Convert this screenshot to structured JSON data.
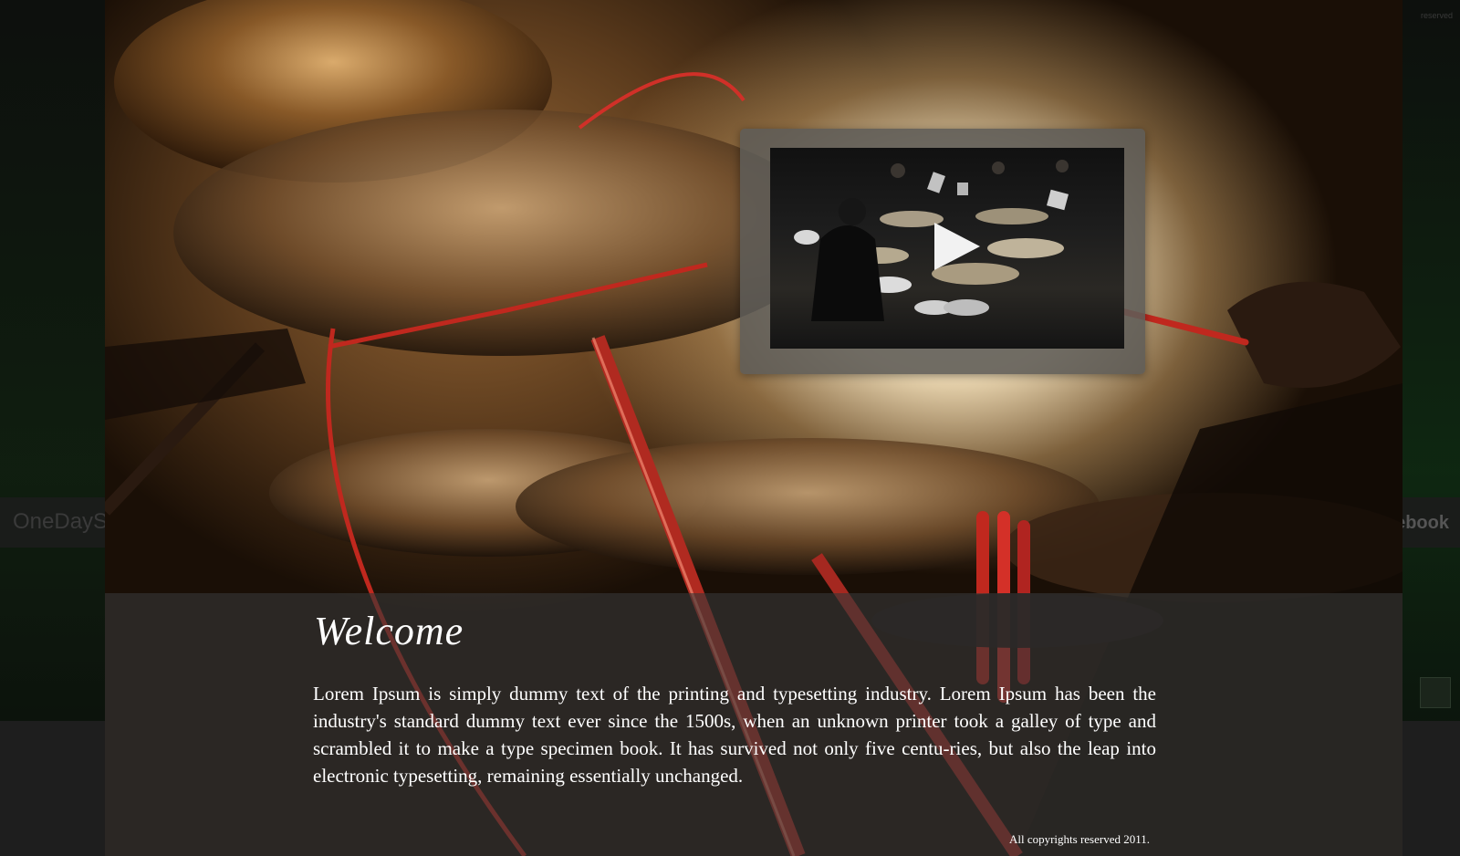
{
  "background_site": {
    "logo_text": "OneDayS",
    "social_text": "ebook",
    "rights_text": "reserved"
  },
  "video": {
    "play_icon": "play-icon"
  },
  "caption": {
    "title": "Welcome",
    "body": "Lorem Ipsum is simply dummy text of the printing and typesetting industry. Lorem Ipsum has been the industry's standard dummy text ever since the 1500s, when an unknown printer took a galley of type and scrambled it to make a type specimen book. It has survived not only five centu-ries, but also the leap into electronic typesetting, remaining essentially unchanged.",
    "copyright": "All copyrights reserved 2011."
  },
  "colors": {
    "caption_bg": "#373737",
    "card_bg": "#5f5c58",
    "accent_red": "#c0281e"
  }
}
